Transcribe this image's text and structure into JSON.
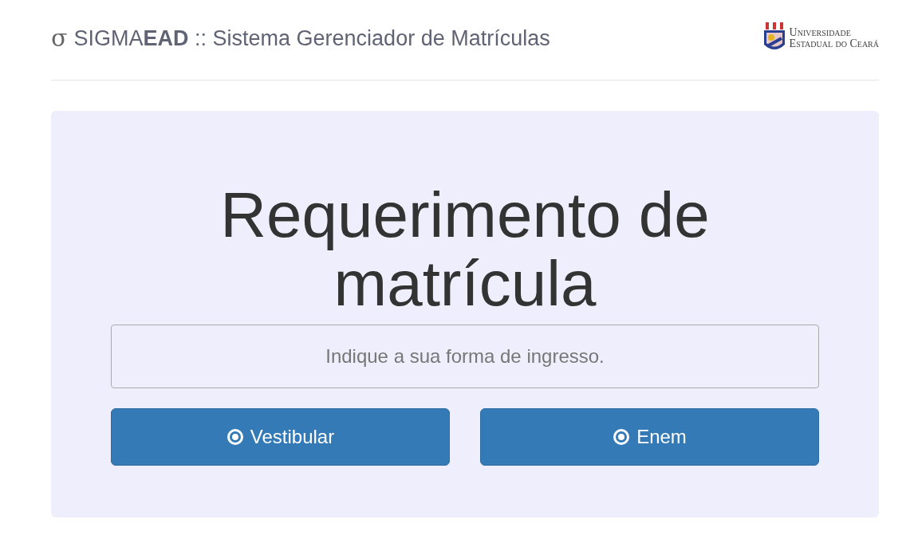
{
  "header": {
    "symbol": "σ",
    "title": "SIGMA**EAD** :: Sistema Gerenciador de Matrículas",
    "logo_lines": [
      "Universidade",
      "Estadual do Ceará"
    ]
  },
  "panel": {
    "heading": "Requerimento de matrícula",
    "prompt": "Indique a sua forma de ingresso.",
    "buttons": [
      {
        "label": "Vestibular"
      },
      {
        "label": "Enem"
      }
    ]
  }
}
